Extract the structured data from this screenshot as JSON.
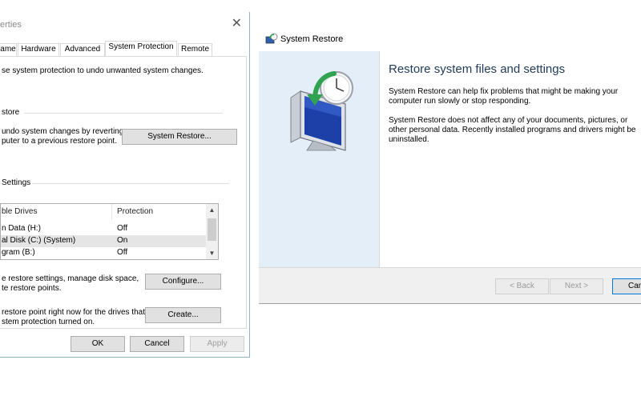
{
  "props_dialog": {
    "title": "erties",
    "close_glyph": "✕",
    "tabs": [
      "ame",
      "Hardware",
      "Advanced",
      "System Protection",
      "Remote"
    ],
    "intro": "se system protection to undo unwanted system changes.",
    "restore_group": "store",
    "restore_desc": [
      "undo system changes by reverting",
      "puter to a previous restore point."
    ],
    "system_restore_button": "System Restore...",
    "settings_group": "Settings",
    "drives_headers": [
      "ble Drives",
      "Protection"
    ],
    "drives": [
      {
        "name": "n Data (H:)",
        "protection": "Off"
      },
      {
        "name": "al Disk (C:) (System)",
        "protection": "On"
      },
      {
        "name": "gram (B:)",
        "protection": "Off"
      }
    ],
    "configure_desc": [
      "e restore settings, manage disk space,",
      "te restore points."
    ],
    "configure_button": "Configure...",
    "create_desc": [
      "restore point right now for the drives that",
      "stem protection turned on."
    ],
    "create_button": "Create...",
    "ok_button": "OK",
    "cancel_button": "Cancel",
    "apply_button": "Apply"
  },
  "restore_dialog": {
    "title": "System Restore",
    "heading": "Restore system files and settings",
    "para1": "System Restore can help fix problems that might be making your computer run slowly or stop responding.",
    "para2": "System Restore does not affect any of your documents, pictures, or other personal data. Recently installed programs and drivers might be uninstalled.",
    "back_button": "< Back",
    "next_button": "Next >",
    "cancel_button": "Canc"
  },
  "icons": [
    "close-icon",
    "system-restore-icon",
    "restore-monitor-clock-icon",
    "scroll-up-icon",
    "scroll-down-icon"
  ]
}
